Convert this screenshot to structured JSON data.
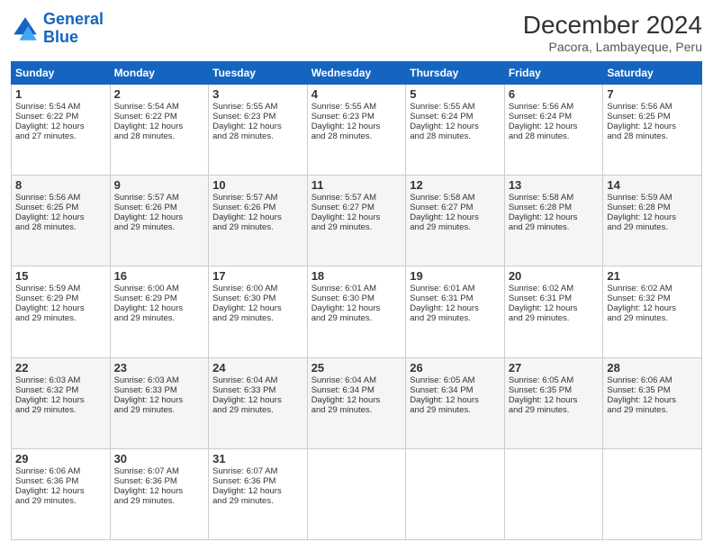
{
  "header": {
    "logo_line1": "General",
    "logo_line2": "Blue",
    "title": "December 2024",
    "subtitle": "Pacora, Lambayeque, Peru"
  },
  "days_of_week": [
    "Sunday",
    "Monday",
    "Tuesday",
    "Wednesday",
    "Thursday",
    "Friday",
    "Saturday"
  ],
  "weeks": [
    [
      {
        "day": "1",
        "lines": [
          "Sunrise: 5:54 AM",
          "Sunset: 6:22 PM",
          "Daylight: 12 hours",
          "and 27 minutes."
        ]
      },
      {
        "day": "2",
        "lines": [
          "Sunrise: 5:54 AM",
          "Sunset: 6:22 PM",
          "Daylight: 12 hours",
          "and 28 minutes."
        ]
      },
      {
        "day": "3",
        "lines": [
          "Sunrise: 5:55 AM",
          "Sunset: 6:23 PM",
          "Daylight: 12 hours",
          "and 28 minutes."
        ]
      },
      {
        "day": "4",
        "lines": [
          "Sunrise: 5:55 AM",
          "Sunset: 6:23 PM",
          "Daylight: 12 hours",
          "and 28 minutes."
        ]
      },
      {
        "day": "5",
        "lines": [
          "Sunrise: 5:55 AM",
          "Sunset: 6:24 PM",
          "Daylight: 12 hours",
          "and 28 minutes."
        ]
      },
      {
        "day": "6",
        "lines": [
          "Sunrise: 5:56 AM",
          "Sunset: 6:24 PM",
          "Daylight: 12 hours",
          "and 28 minutes."
        ]
      },
      {
        "day": "7",
        "lines": [
          "Sunrise: 5:56 AM",
          "Sunset: 6:25 PM",
          "Daylight: 12 hours",
          "and 28 minutes."
        ]
      }
    ],
    [
      {
        "day": "8",
        "lines": [
          "Sunrise: 5:56 AM",
          "Sunset: 6:25 PM",
          "Daylight: 12 hours",
          "and 28 minutes."
        ]
      },
      {
        "day": "9",
        "lines": [
          "Sunrise: 5:57 AM",
          "Sunset: 6:26 PM",
          "Daylight: 12 hours",
          "and 29 minutes."
        ]
      },
      {
        "day": "10",
        "lines": [
          "Sunrise: 5:57 AM",
          "Sunset: 6:26 PM",
          "Daylight: 12 hours",
          "and 29 minutes."
        ]
      },
      {
        "day": "11",
        "lines": [
          "Sunrise: 5:57 AM",
          "Sunset: 6:27 PM",
          "Daylight: 12 hours",
          "and 29 minutes."
        ]
      },
      {
        "day": "12",
        "lines": [
          "Sunrise: 5:58 AM",
          "Sunset: 6:27 PM",
          "Daylight: 12 hours",
          "and 29 minutes."
        ]
      },
      {
        "day": "13",
        "lines": [
          "Sunrise: 5:58 AM",
          "Sunset: 6:28 PM",
          "Daylight: 12 hours",
          "and 29 minutes."
        ]
      },
      {
        "day": "14",
        "lines": [
          "Sunrise: 5:59 AM",
          "Sunset: 6:28 PM",
          "Daylight: 12 hours",
          "and 29 minutes."
        ]
      }
    ],
    [
      {
        "day": "15",
        "lines": [
          "Sunrise: 5:59 AM",
          "Sunset: 6:29 PM",
          "Daylight: 12 hours",
          "and 29 minutes."
        ]
      },
      {
        "day": "16",
        "lines": [
          "Sunrise: 6:00 AM",
          "Sunset: 6:29 PM",
          "Daylight: 12 hours",
          "and 29 minutes."
        ]
      },
      {
        "day": "17",
        "lines": [
          "Sunrise: 6:00 AM",
          "Sunset: 6:30 PM",
          "Daylight: 12 hours",
          "and 29 minutes."
        ]
      },
      {
        "day": "18",
        "lines": [
          "Sunrise: 6:01 AM",
          "Sunset: 6:30 PM",
          "Daylight: 12 hours",
          "and 29 minutes."
        ]
      },
      {
        "day": "19",
        "lines": [
          "Sunrise: 6:01 AM",
          "Sunset: 6:31 PM",
          "Daylight: 12 hours",
          "and 29 minutes."
        ]
      },
      {
        "day": "20",
        "lines": [
          "Sunrise: 6:02 AM",
          "Sunset: 6:31 PM",
          "Daylight: 12 hours",
          "and 29 minutes."
        ]
      },
      {
        "day": "21",
        "lines": [
          "Sunrise: 6:02 AM",
          "Sunset: 6:32 PM",
          "Daylight: 12 hours",
          "and 29 minutes."
        ]
      }
    ],
    [
      {
        "day": "22",
        "lines": [
          "Sunrise: 6:03 AM",
          "Sunset: 6:32 PM",
          "Daylight: 12 hours",
          "and 29 minutes."
        ]
      },
      {
        "day": "23",
        "lines": [
          "Sunrise: 6:03 AM",
          "Sunset: 6:33 PM",
          "Daylight: 12 hours",
          "and 29 minutes."
        ]
      },
      {
        "day": "24",
        "lines": [
          "Sunrise: 6:04 AM",
          "Sunset: 6:33 PM",
          "Daylight: 12 hours",
          "and 29 minutes."
        ]
      },
      {
        "day": "25",
        "lines": [
          "Sunrise: 6:04 AM",
          "Sunset: 6:34 PM",
          "Daylight: 12 hours",
          "and 29 minutes."
        ]
      },
      {
        "day": "26",
        "lines": [
          "Sunrise: 6:05 AM",
          "Sunset: 6:34 PM",
          "Daylight: 12 hours",
          "and 29 minutes."
        ]
      },
      {
        "day": "27",
        "lines": [
          "Sunrise: 6:05 AM",
          "Sunset: 6:35 PM",
          "Daylight: 12 hours",
          "and 29 minutes."
        ]
      },
      {
        "day": "28",
        "lines": [
          "Sunrise: 6:06 AM",
          "Sunset: 6:35 PM",
          "Daylight: 12 hours",
          "and 29 minutes."
        ]
      }
    ],
    [
      {
        "day": "29",
        "lines": [
          "Sunrise: 6:06 AM",
          "Sunset: 6:36 PM",
          "Daylight: 12 hours",
          "and 29 minutes."
        ]
      },
      {
        "day": "30",
        "lines": [
          "Sunrise: 6:07 AM",
          "Sunset: 6:36 PM",
          "Daylight: 12 hours",
          "and 29 minutes."
        ]
      },
      {
        "day": "31",
        "lines": [
          "Sunrise: 6:07 AM",
          "Sunset: 6:36 PM",
          "Daylight: 12 hours",
          "and 29 minutes."
        ]
      },
      null,
      null,
      null,
      null
    ]
  ]
}
